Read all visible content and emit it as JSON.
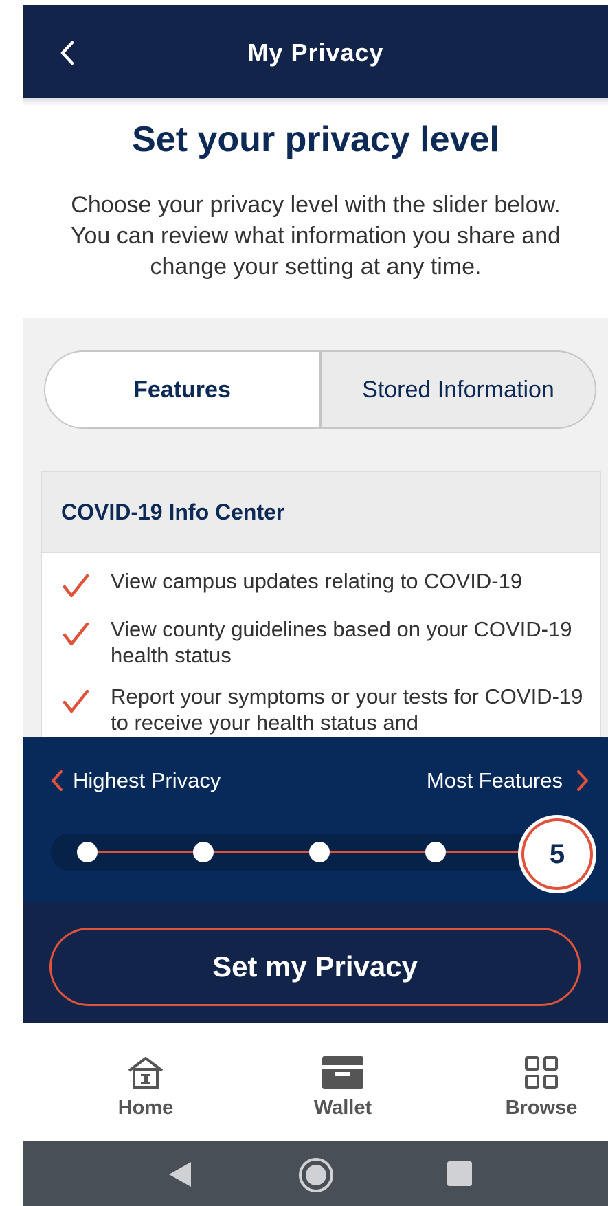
{
  "header": {
    "title": "My Privacy"
  },
  "page": {
    "title": "Set your privacy level",
    "intro": "Choose your privacy level with the slider below. You can review what information you share and change your setting at any time."
  },
  "tabs": {
    "features": "Features",
    "stored": "Stored Information",
    "active": "features"
  },
  "card": {
    "title": "COVID-19 Info Center",
    "items": [
      "View campus updates relating to COVID-19",
      "View county guidelines based on your COVID-19 health status",
      "Report your symptoms or your tests for COVID-19 to receive your health status and"
    ]
  },
  "slider": {
    "left_label": "Highest Privacy",
    "right_label": "Most Features",
    "value": "5",
    "max": 5
  },
  "action": {
    "label": "Set my Privacy"
  },
  "bottom_nav": {
    "home": "Home",
    "wallet": "Wallet",
    "browse": "Browse"
  },
  "colors": {
    "navy": "#13244a",
    "slider_bg": "#072a5a",
    "accent": "#e0533a",
    "title": "#0d2a56"
  }
}
